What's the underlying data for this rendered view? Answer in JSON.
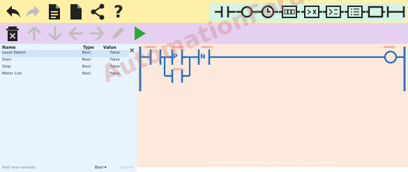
{
  "toolbar_top": {
    "buttons": [
      "undo",
      "redo",
      "new-file",
      "save-file",
      "share",
      "help"
    ],
    "help_label": "?"
  },
  "ladder_tools": [
    "contact",
    "coil",
    "timer",
    "counter",
    "compare",
    "math",
    "move",
    "branch-close",
    "branch"
  ],
  "toolbar_second": {
    "buttons": [
      "delete",
      "move-up",
      "move-down",
      "move-left",
      "move-right",
      "edit",
      "run"
    ]
  },
  "colors": {
    "toolbar_top_bg": "#fff0a8",
    "toolbar_second_bg": "#e6d0f2",
    "ladder_tools_bg": "#d6f3e4",
    "variables_bg": "#e7f4ff",
    "canvas_bg": "#fde9dc",
    "rung_line": "#1f6fc4",
    "select_text": "#e53935",
    "run_green": "#2fa83a"
  },
  "variables": {
    "headers": {
      "name": "Name",
      "type": "Type",
      "value": "Value"
    },
    "close_label": "✕",
    "rows": [
      {
        "name": "Level Switch",
        "type": "Bool",
        "value": "False"
      },
      {
        "name": "Start",
        "type": "Bool",
        "value": "False"
      },
      {
        "name": "Stop",
        "type": "Bool",
        "value": "False"
      },
      {
        "name": "Motor Coil",
        "type": "Bool",
        "value": "False"
      }
    ]
  },
  "footer": {
    "placeholder": "Add new variable",
    "type_value": "Bool",
    "submit_label": "Submit"
  },
  "canvas": {
    "select_label": "--Select--",
    "contact_p_label": "P",
    "contact_n_label": "N",
    "note": "Simulated with free version of ladder diagrams. Full version doesn't put watermark."
  },
  "watermark": "AutomationForum.co"
}
